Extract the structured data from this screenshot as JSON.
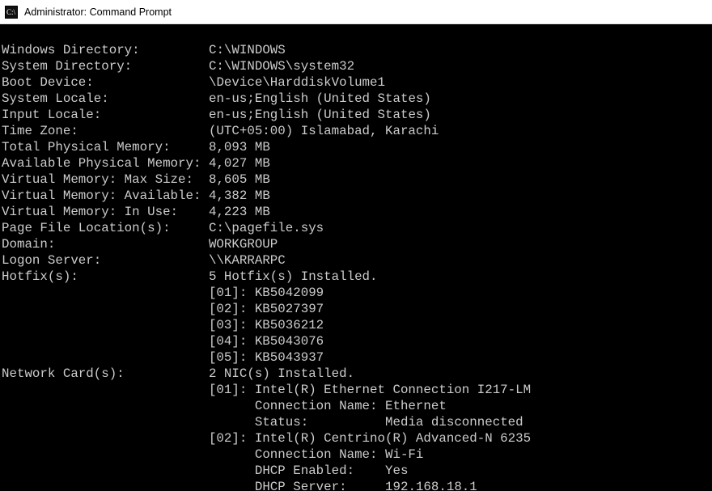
{
  "titlebar": {
    "title": "Administrator: Command Prompt"
  },
  "fields": {
    "windows_dir": {
      "label": "Windows Directory:",
      "value": "C:\\WINDOWS"
    },
    "system_dir": {
      "label": "System Directory:",
      "value": "C:\\WINDOWS\\system32"
    },
    "boot_device": {
      "label": "Boot Device:",
      "value": "\\Device\\HarddiskVolume1"
    },
    "system_locale": {
      "label": "System Locale:",
      "value": "en-us;English (United States)"
    },
    "input_locale": {
      "label": "Input Locale:",
      "value": "en-us;English (United States)"
    },
    "time_zone": {
      "label": "Time Zone:",
      "value": "(UTC+05:00) Islamabad, Karachi"
    },
    "total_phys_mem": {
      "label": "Total Physical Memory:",
      "value": "8,093 MB"
    },
    "avail_phys_mem": {
      "label": "Available Physical Memory:",
      "value": "4,027 MB"
    },
    "vm_max": {
      "label": "Virtual Memory: Max Size:",
      "value": "8,605 MB"
    },
    "vm_avail": {
      "label": "Virtual Memory: Available:",
      "value": "4,382 MB"
    },
    "vm_inuse": {
      "label": "Virtual Memory: In Use:",
      "value": "4,223 MB"
    },
    "pagefile": {
      "label": "Page File Location(s):",
      "value": "C:\\pagefile.sys"
    },
    "domain": {
      "label": "Domain:",
      "value": "WORKGROUP"
    },
    "logon_server": {
      "label": "Logon Server:",
      "value": "\\\\KARRARPC"
    },
    "hotfix_header": {
      "label": "Hotfix(s):",
      "value": "5 Hotfix(s) Installed."
    },
    "hotfixes": [
      "[01]: KB5042099",
      "[02]: KB5027397",
      "[03]: KB5036212",
      "[04]: KB5043076",
      "[05]: KB5043937"
    ],
    "nic_header": {
      "label": "Network Card(s):",
      "value": "2 NIC(s) Installed."
    },
    "nic1_name": "[01]: Intel(R) Ethernet Connection I217-LM",
    "nic1_conn": "Connection Name: Ethernet",
    "nic1_status_label": "Status:",
    "nic1_status_value": "Media disconnected",
    "nic2_name": "[02]: Intel(R) Centrino(R) Advanced-N 6235",
    "nic2_conn": "Connection Name: Wi-Fi",
    "nic2_dhcp_en_label": "DHCP Enabled:",
    "nic2_dhcp_en_value": "Yes",
    "nic2_dhcp_srv_label": "DHCP Server:",
    "nic2_dhcp_srv_value": "192.168.18.1"
  }
}
